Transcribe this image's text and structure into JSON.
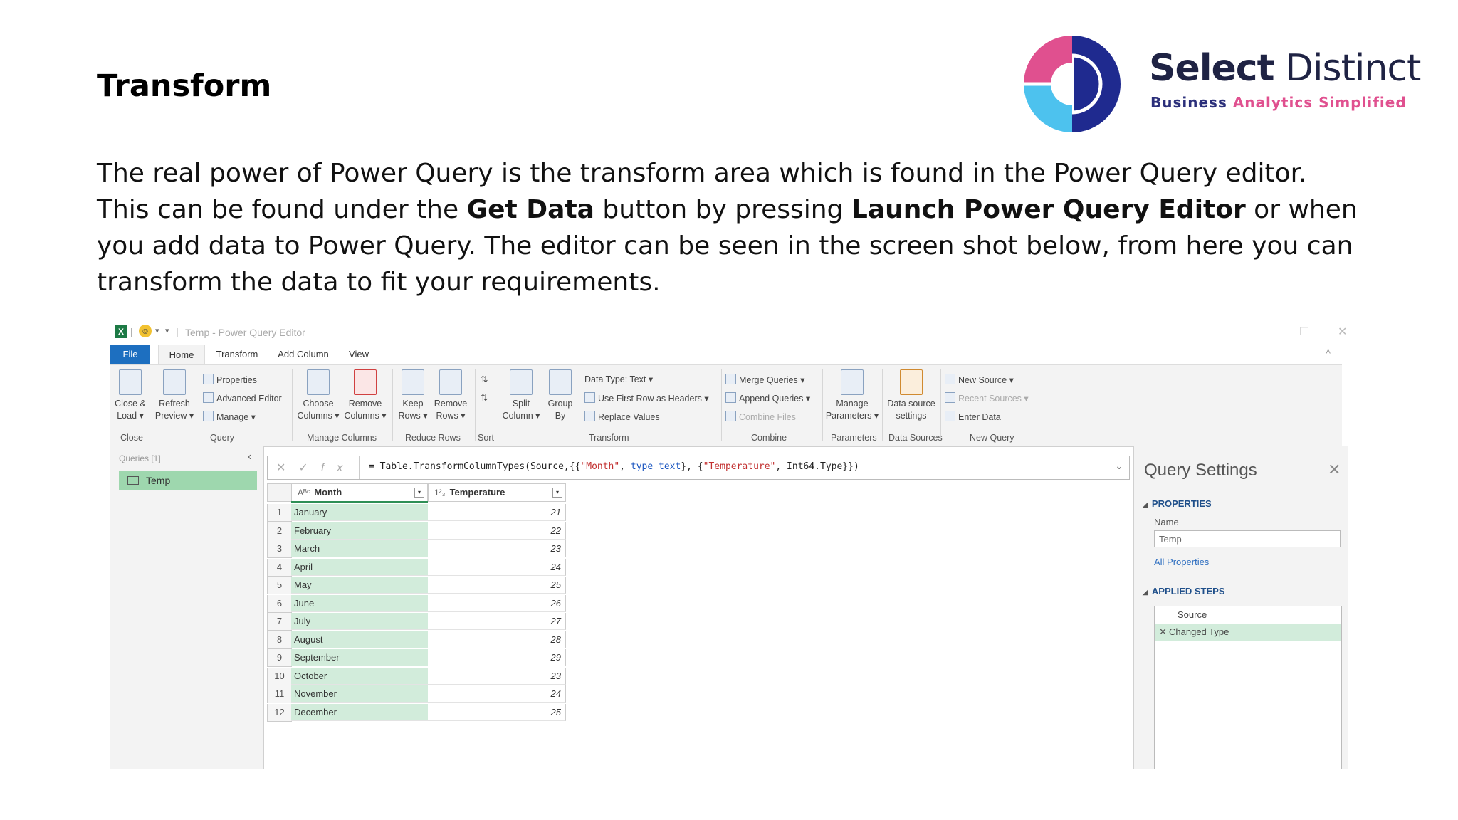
{
  "slide": {
    "title": "Transform",
    "para1": "The real power of Power Query is the transform area which is found in the Power Query editor.",
    "para2_a": "This can be found under the ",
    "para2_b": "Get Data",
    "para2_c": " button by pressing ",
    "para2_d": "Launch Power Query Editor",
    "para2_e": " or when you add data to Power Query. The editor can be seen in the screen shot below, from here you can transform the data to fit your requirements."
  },
  "logo": {
    "name_bold": "Select",
    "name_regular": "Distinct",
    "tagline_a": "Business",
    "tagline_b": "Analytics Simplified",
    "colors": {
      "pink": "#e0508f",
      "navy": "#1f2a8f",
      "cyan": "#4dc2ee"
    }
  },
  "editor": {
    "window_title": "Temp - Power Query Editor",
    "tabs": [
      "File",
      "Home",
      "Transform",
      "Add Column",
      "View"
    ],
    "ribbon": {
      "close_load": "Close & Load",
      "refresh_preview": "Refresh Preview",
      "properties": "Properties",
      "advanced_editor": "Advanced Editor",
      "manage": "Manage",
      "choose_columns": "Choose Columns",
      "remove_columns": "Remove Columns",
      "keep_rows": "Keep Rows",
      "remove_rows": "Remove Rows",
      "split_column": "Split Column",
      "group_by": "Group By",
      "data_type": "Data Type: Text",
      "use_first_row": "Use First Row as Headers",
      "replace_values": "Replace Values",
      "merge_queries": "Merge Queries",
      "append_queries": "Append Queries",
      "combine_files": "Combine Files",
      "manage_parameters": "Manage Parameters",
      "data_source_settings": "Data source settings",
      "new_source": "New Source",
      "recent_sources": "Recent Sources",
      "enter_data": "Enter Data",
      "groups": {
        "close": "Close",
        "query": "Query",
        "manage_columns": "Manage Columns",
        "reduce_rows": "Reduce Rows",
        "sort": "Sort",
        "transform": "Transform",
        "combine": "Combine",
        "parameters": "Parameters",
        "data_sources": "Data Sources",
        "new_query": "New Query"
      }
    },
    "queries": {
      "header": "Queries [1]",
      "items": [
        "Temp"
      ]
    },
    "formula": {
      "prefix": "= Table.TransformColumnTypes(Source,{{",
      "s1": "\"Month\"",
      "mid1": ", ",
      "kw1": "type text",
      "mid2": "}, {",
      "s2": "\"Temperature\"",
      "suffix": ", Int64.Type}})"
    },
    "table": {
      "columns": [
        {
          "type_icon": "Aᴮᶜ",
          "name": "Month"
        },
        {
          "type_icon": "1²₃",
          "name": "Temperature"
        }
      ],
      "rows": [
        {
          "n": "1",
          "month": "January",
          "temp": "21"
        },
        {
          "n": "2",
          "month": "February",
          "temp": "22"
        },
        {
          "n": "3",
          "month": "March",
          "temp": "23"
        },
        {
          "n": "4",
          "month": "April",
          "temp": "24"
        },
        {
          "n": "5",
          "month": "May",
          "temp": "25"
        },
        {
          "n": "6",
          "month": "June",
          "temp": "26"
        },
        {
          "n": "7",
          "month": "July",
          "temp": "27"
        },
        {
          "n": "8",
          "month": "August",
          "temp": "28"
        },
        {
          "n": "9",
          "month": "September",
          "temp": "29"
        },
        {
          "n": "10",
          "month": "October",
          "temp": "23"
        },
        {
          "n": "11",
          "month": "November",
          "temp": "24"
        },
        {
          "n": "12",
          "month": "December",
          "temp": "25"
        }
      ]
    },
    "settings": {
      "title": "Query Settings",
      "properties": "PROPERTIES",
      "name_label": "Name",
      "name_value": "Temp",
      "all_properties": "All Properties",
      "applied_steps": "APPLIED STEPS",
      "steps": [
        "Source",
        "Changed Type"
      ]
    }
  }
}
